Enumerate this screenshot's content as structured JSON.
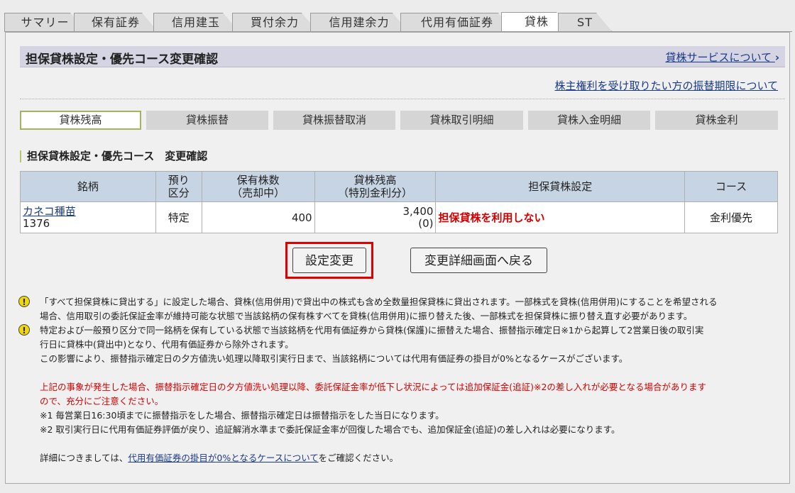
{
  "tabs": [
    "サマリー",
    "保有証券",
    "信用建玉",
    "買付余力",
    "信用建余力",
    "代用有価証券",
    "貸株",
    "ST"
  ],
  "active_tab": "貸株",
  "page_title": "担保貸株設定・優先コース変更確認",
  "link_service": "貸株サービスについて",
  "link_service_arrow": "›",
  "link_rights": "株主権利を受け取りたい方の振替期限について",
  "subnav": [
    "貸株残高",
    "貸株振替",
    "貸株振替取消",
    "貸株取引明細",
    "貸株入金明細",
    "貸株金利"
  ],
  "section_title": "担保貸株設定・優先コース　変更確認",
  "table": {
    "headers": {
      "stock": "銘柄",
      "custody_1": "預り",
      "custody_2": "区分",
      "held_1": "保有株数",
      "held_2": "（売却中）",
      "lent_1": "貸株残高",
      "lent_2": "（特別金利分）",
      "collateral": "担保貸株設定",
      "course": "コース"
    },
    "row": {
      "name": "カネコ種苗",
      "code": "1376",
      "custody": "特定",
      "held": "400",
      "lent": "3,400",
      "lent_special": "(0)",
      "collateral": "担保貸株を利用しない",
      "course": "金利優先"
    }
  },
  "buttons": {
    "change": "設定変更",
    "back": "変更詳細画面へ戻る"
  },
  "notes": {
    "icon": "!",
    "n1a": "「すべて担保貸株に貸出する」に設定した場合、貸株(信用併用)で貸出中の株式も含め全数量担保貸株に貸出されます。一部株式を貸株(信用併用)にすることを希望される",
    "n1b": "場合、信用取引の委託保証金率が維持可能な状態で当該銘柄の保有株すべてを貸株(信用併用)に振り替えた後、一部株式を担保貸株に振り替え直す必要があります。",
    "n2a": "特定および一般預り区分で同一銘柄を保有している状態で当該銘柄を代用有価証券から貸株(保護)に振替えた場合、振替指示確定日※1から起算して2営業日後の取引実",
    "n2b": "行日に貸株中(貸出中)となり、代用有価証券から除外されます。",
    "n2c": "この影響により、振替指示確定日の夕方値洗い処理以降取引実行日まで、当該銘柄については代用有価証券の掛目が0%となるケースがございます。",
    "red1": "上記の事象が発生した場合、振替指示確定日の夕方値洗い処理以降、委託保証金率が低下し状況によっては追加保証金(追証)※2の差し入れが必要となる場合があります",
    "red2": "ので、充分にご注意ください。",
    "f1": "※1 毎営業日16:30頃までに振替指示をした場合、振替指示確定日は振替指示をした当日になります。",
    "f2": "※2 取引実行日に代用有価証券評価が戻り、追証解消水準まで委託保証金率が回復した場合でも、追加保証金(追証)の差し入れは必要になります。",
    "detail_pre": "詳細につきましては、",
    "detail_link": "代用有価証券の掛目が0%となるケースについて",
    "detail_post": "をご確認ください。"
  },
  "colors": {
    "title_bg": "#d4d4e2",
    "header_bg": "#c7d4e3",
    "highlight": "#e00000",
    "warning_red": "#d40000",
    "link": "#1a3a8a"
  }
}
